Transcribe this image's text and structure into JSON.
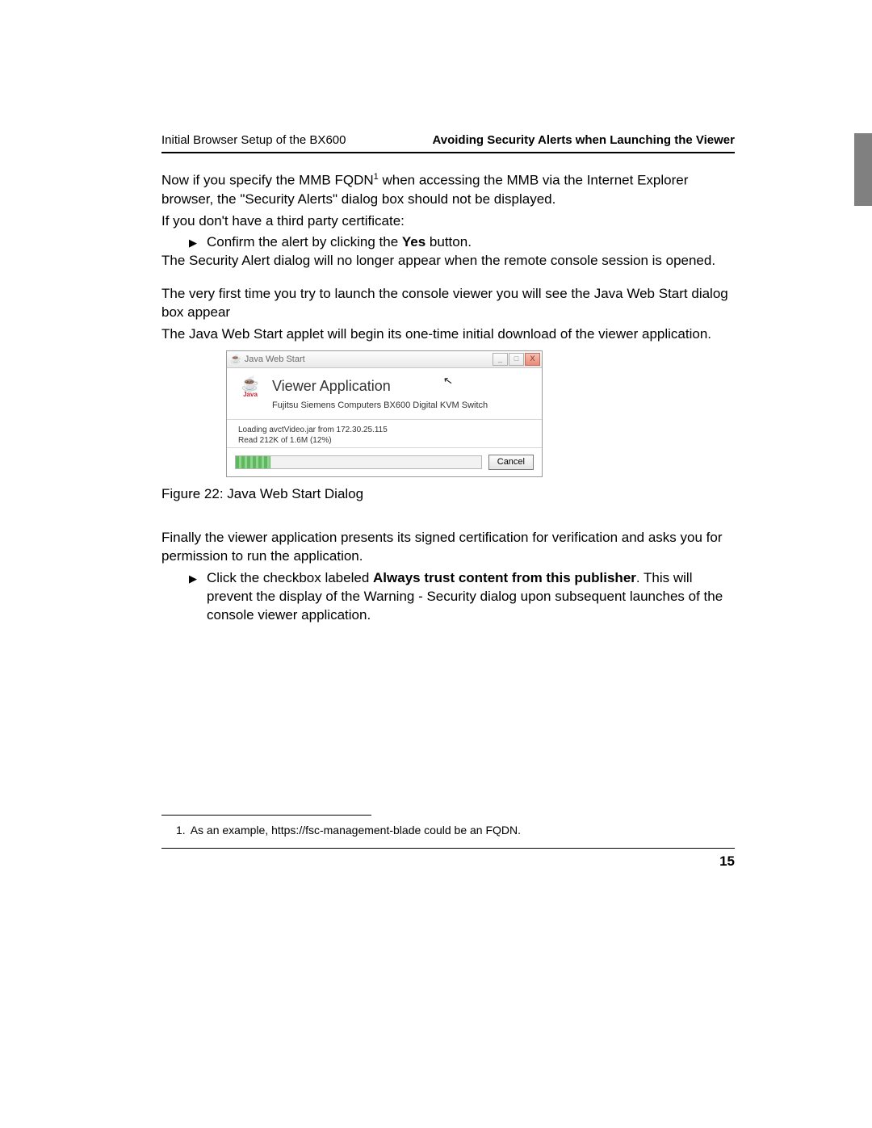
{
  "header": {
    "left": "Initial Browser Setup of the BX600",
    "right": "Avoiding Security Alerts when Launching the Viewer"
  },
  "body": {
    "p1a": "Now if you specify the MMB FQDN",
    "p1sup": "1",
    "p1b": " when accessing the MMB via the Internet Explorer browser, the \"Security Alerts\" dialog box should not be displayed.",
    "p2": "If you don't have a third party certificate:",
    "b1a": "Confirm the alert by clicking the ",
    "b1bold": "Yes",
    "b1b": " button.",
    "p3": "The Security Alert dialog will no longer appear when the remote console session is opened.",
    "p4": "The very first time you try to launch the console viewer you will see the Java Web Start dialog box appear",
    "p5": "The Java Web Start applet will begin its one-time initial download of the viewer application.",
    "figcap": "Figure 22: Java Web Start Dialog",
    "p6": "Finally the viewer application presents its signed certification for verification and asks you for permission to run the application.",
    "b2a": "Click the checkbox labeled ",
    "b2bold": "Always trust content from this publisher",
    "b2b": ". This will prevent the display of the Warning - Security dialog upon subsequent launches of the console viewer application."
  },
  "dialog": {
    "title": "Java Web Start",
    "heading": "Viewer Application",
    "subheading": "Fujitsu Siemens Computers BX600 Digital KVM Switch",
    "status1": "Loading avctVideo.jar from 172.30.25.115",
    "status2": "Read 212K of 1.6M (12%)",
    "cancel": "Cancel",
    "java_word": "Java",
    "min": "_",
    "max": "□",
    "close": "X"
  },
  "footnote": {
    "num": "1.",
    "text": "As an example, https://fsc-management-blade could be an FQDN."
  },
  "page_number": "15"
}
